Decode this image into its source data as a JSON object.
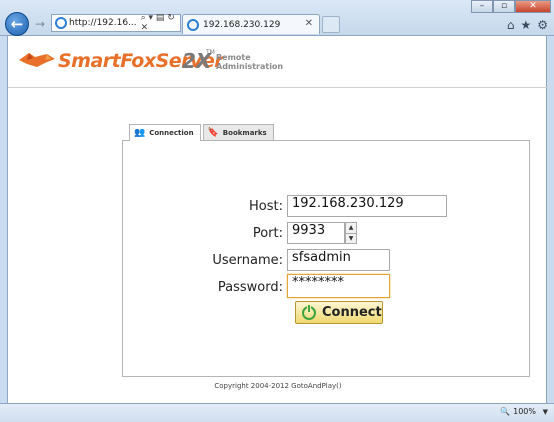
{
  "browser": {
    "address": "http://192.16...",
    "address_controls": "⌕ ▾ ▤ ↻ ✕",
    "tab_title": "192.168.230.129",
    "zoom": "100%"
  },
  "header": {
    "brand": "SmartFoxServer",
    "version": "2X",
    "tm": "TM",
    "subtitle": "Remote Administration"
  },
  "tabs": [
    {
      "label": "Connection",
      "icon": "people-icon",
      "active": true
    },
    {
      "label": "Bookmarks",
      "icon": "bookmark-icon",
      "active": false
    }
  ],
  "form": {
    "host_label": "Host:",
    "host_value": "192.168.230.129",
    "port_label": "Port:",
    "port_value": "9933",
    "username_label": "Username:",
    "username_value": "sfsadmin",
    "password_label": "Password:",
    "password_value": "********",
    "connect_label": "Connect"
  },
  "footer": {
    "copyright": "Copyright 2004-2012 GotoAndPlay()"
  },
  "colors": {
    "brand_orange": "#e8702a",
    "button_yellow": "#f0d872",
    "power_green": "#3ea33e"
  }
}
